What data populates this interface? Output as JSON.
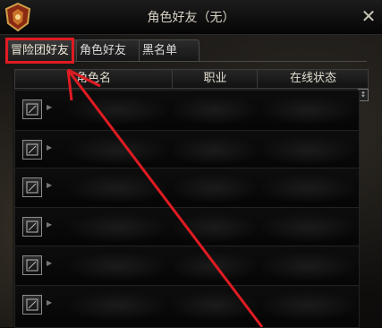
{
  "window": {
    "title": "角色好友（无）",
    "close_label": "✕",
    "side_caption": "↕"
  },
  "tabs": [
    {
      "label": "冒险团好友",
      "active": true
    },
    {
      "label": "角色好友",
      "active": false
    },
    {
      "label": "黑名单",
      "active": false
    }
  ],
  "columns": {
    "name": "角色名",
    "job": "职业",
    "status": "在线状态"
  },
  "rows": [
    {
      "name": "",
      "job": "",
      "status": ""
    },
    {
      "name": "",
      "job": "",
      "status": ""
    },
    {
      "name": "",
      "job": "",
      "status": ""
    },
    {
      "name": "",
      "job": "",
      "status": ""
    },
    {
      "name": "",
      "job": "",
      "status": ""
    },
    {
      "name": "",
      "job": "",
      "status": ""
    }
  ],
  "colors": {
    "annotation": "#e01b22",
    "header_text": "#e0dccf"
  }
}
